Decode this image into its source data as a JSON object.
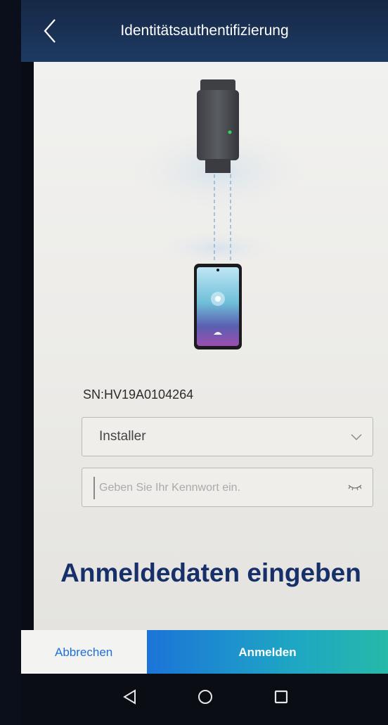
{
  "header": {
    "title": "Identitätsauthentifizierung",
    "back_icon": "chevron-left-icon"
  },
  "device": {
    "serial": "SN:HV19A0104264"
  },
  "form": {
    "role_selected": "Installer",
    "password_placeholder": "Geben Sie Ihr Kennwort ein.",
    "password_value": ""
  },
  "caption": "Anmeldedaten eingeben",
  "footer": {
    "cancel_label": "Abbrechen",
    "login_label": "Anmelden"
  },
  "navbar": {
    "icons": [
      "back-triangle-icon",
      "home-circle-icon",
      "recents-square-icon"
    ]
  },
  "colors": {
    "header": "#1d3a63",
    "accent_blue": "#1f6fd8",
    "login_gradient_start": "#1c74d8",
    "login_gradient_end": "#27b9a9",
    "caption": "#18306a"
  }
}
